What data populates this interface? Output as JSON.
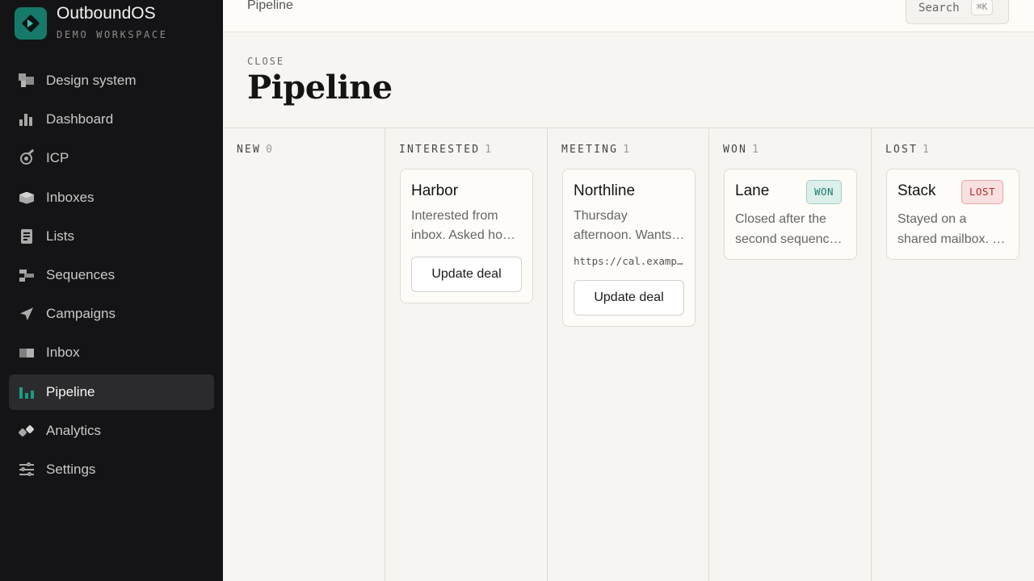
{
  "brand": {
    "name": "OutboundOS",
    "workspace": "DEMO WORKSPACE"
  },
  "sidebar": {
    "items": [
      {
        "label": "Design system",
        "icon": "design-system-icon"
      },
      {
        "label": "Dashboard",
        "icon": "bar-chart-icon"
      },
      {
        "label": "ICP",
        "icon": "target-icon"
      },
      {
        "label": "Inboxes",
        "icon": "box-icon"
      },
      {
        "label": "Lists",
        "icon": "document-icon"
      },
      {
        "label": "Sequences",
        "icon": "sequence-icon"
      },
      {
        "label": "Campaigns",
        "icon": "send-icon"
      },
      {
        "label": "Inbox",
        "icon": "inbox-icon"
      },
      {
        "label": "Pipeline",
        "icon": "pipeline-icon",
        "active": true
      },
      {
        "label": "Analytics",
        "icon": "analytics-icon"
      },
      {
        "label": "Settings",
        "icon": "sliders-icon"
      }
    ]
  },
  "topbar": {
    "breadcrumb": "Pipeline",
    "search_label": "Search",
    "search_shortcut": "⌘K"
  },
  "header": {
    "eyebrow": "CLOSE",
    "title": "Pipeline"
  },
  "columns": [
    {
      "name": "NEW",
      "count": "0",
      "cards": []
    },
    {
      "name": "INTERESTED",
      "count": "1",
      "cards": [
        {
          "name": "Harbor",
          "desc1": "Interested from",
          "desc2": "inbox. Asked how it works",
          "button": "Update deal"
        }
      ]
    },
    {
      "name": "MEETING",
      "count": "1",
      "cards": [
        {
          "name": "Northline",
          "desc1": "Thursday",
          "desc2": "afternoon. Wants to talk",
          "link": "https://cal.example.com",
          "button": "Update deal"
        }
      ]
    },
    {
      "name": "WON",
      "count": "1",
      "cards": [
        {
          "name": "Lane",
          "badge": "WON",
          "desc1": "Closed after the",
          "desc2": "second sequence step"
        }
      ]
    },
    {
      "name": "LOST",
      "count": "1",
      "cards": [
        {
          "name": "Stack",
          "badge": "LOST",
          "desc1": "Stayed on a",
          "desc2": "shared mailbox. Not a fit"
        }
      ]
    }
  ],
  "colors": {
    "accent": "#167a6a",
    "sidebar_bg": "#141416",
    "page_bg": "#f6f5f1",
    "won": "#1b7d6c",
    "lost": "#b42d2d"
  }
}
